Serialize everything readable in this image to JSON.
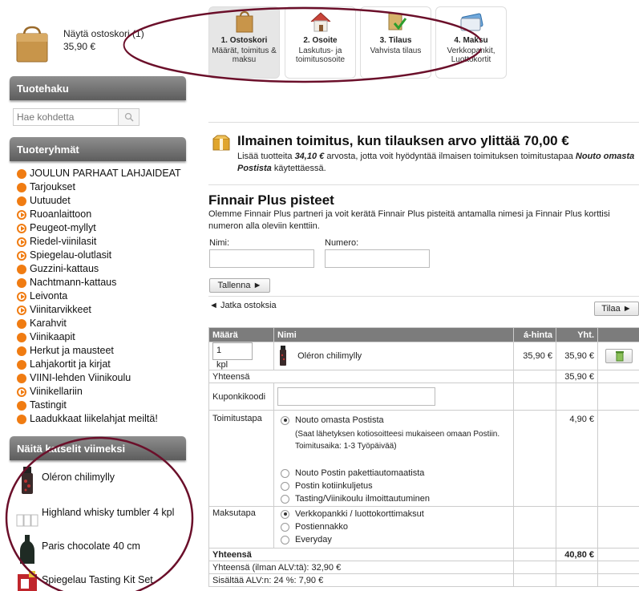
{
  "mini_cart": {
    "link": "Näytä ostoskori (1)",
    "total": "35,90 €"
  },
  "steps": [
    {
      "title": "1. Ostoskori",
      "sub": "Määrät, toimitus & maksu"
    },
    {
      "title": "2. Osoite",
      "sub": "Laskutus- ja toimitusosoite"
    },
    {
      "title": "3. Tilaus",
      "sub": "Vahvista tilaus"
    },
    {
      "title": "4. Maksu",
      "sub": "Verkkopankit, Luottokortit"
    }
  ],
  "search": {
    "heading": "Tuotehaku",
    "placeholder": "Hae kohdetta"
  },
  "categories": {
    "heading": "Tuoteryhmät",
    "items": [
      "JOULUN PARHAAT LAHJAIDEAT",
      "Tarjoukset",
      "Uutuudet",
      "Ruoanlaittoon",
      "Peugeot-myllyt",
      "Riedel-viinilasit",
      "Spiegelau-olutlasit",
      "Guzzini-kattaus",
      "Nachtmann-kattaus",
      "Leivonta",
      "Viinitarvikkeet",
      "Karahvit",
      "Viinikaapit",
      "Herkut ja mausteet",
      "Lahjakortit ja kirjat",
      "VIINI-lehden Viinikoulu",
      "Viinikellariin",
      "Tastingit",
      "Laadukkaat liikelahjat meiltä!"
    ]
  },
  "recent": {
    "heading": "Näitä katselit viimeksi",
    "items": [
      "Oléron chilimylly",
      "Highland whisky tumbler 4 kpl",
      "Paris chocolate 40 cm",
      "Spiegelau Tasting Kit Set"
    ]
  },
  "free_shipping": {
    "title": "Ilmainen toimitus, kun tilauksen arvo ylittää 70,00 €",
    "pre": "Lisää tuotteita ",
    "amount": "34,10 €",
    "mid": " arvosta, jotta voit hyödyntää ilmaisen toimituksen toimitustapaa ",
    "method": "Nouto omasta Postista",
    "post": " käytettäessä."
  },
  "finnair": {
    "title": "Finnair Plus pisteet",
    "text": "Olemme Finnair Plus partneri ja voit kerätä Finnair Plus pisteitä antamalla nimesi ja Finnair Plus korttisi numeron alla oleviin kenttiin.",
    "name_label": "Nimi:",
    "number_label": "Numero:",
    "save_label": "Tallenna ►"
  },
  "continue_label": "◄ Jatka ostoksia",
  "order_label": "Tilaa ►",
  "table": {
    "headers": {
      "qty": "Määrä",
      "name": "Nimi",
      "unit": "á-hinta",
      "total": "Yht."
    },
    "item": {
      "qty": "1",
      "unit_label": "kpl",
      "name": "Oléron chilimylly",
      "unit_price": "35,90 €",
      "total": "35,90 €"
    },
    "subtotal_label": "Yhteensä",
    "subtotal": "35,90 €",
    "coupon_label": "Kuponkikoodi",
    "delivery_label": "Toimitustapa",
    "delivery_selected": "Nouto omasta Postista",
    "delivery_note": "(Saat lähetyksen kotiosoitteesi mukaiseen omaan Postiin. Toimitusaika: 1-3 Työpäivää)",
    "delivery_price": "4,90 €",
    "delivery_options": [
      "Nouto Postin pakettiautomaatista",
      "Postin kotiinkuljetus",
      "Tasting/Viinikoulu ilmoittautuminen"
    ],
    "payment_label": "Maksutapa",
    "payment_options": [
      "Verkkopankki / luottokorttimaksut",
      "Postiennakko",
      "Everyday"
    ],
    "grand_label": "Yhteensä",
    "grand_total": "40,80 €",
    "vat_excl": "Yhteensä (ilman ALV:tä): 32,90 €",
    "vat_incl": "Sisältää ALV:n: 24 %: 7,90 €"
  },
  "colors": {
    "bullet": "#f07c12",
    "header_bar": "#7c7c7c",
    "annotation": "#6b0f2a"
  }
}
